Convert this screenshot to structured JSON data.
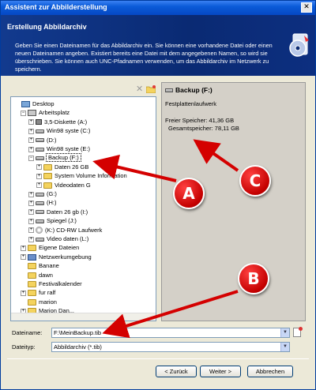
{
  "window": {
    "title": "Assistent zur Abbilderstellung",
    "close_glyph": "✕"
  },
  "banner": {
    "heading": "Erstellung Abbildarchiv",
    "description": "Geben Sie einen Dateinamen für das Abbildarchiv ein. Sie können eine vorhandene Datei oder einen neuen Dateinamen angeben. Existiert bereits eine Datei mit dem angegebenen Namen, so wird sie überschrieben. Sie können auch UNC-Pfadnamen verwenden, um das Abbildarchiv im Netzwerk zu speichern.",
    "icon": "wizard-disc-icon"
  },
  "tree": {
    "items": [
      {
        "label": "Desktop",
        "icon": "desktop-icon",
        "exp": ""
      },
      {
        "label": "Arbeitsplatz",
        "icon": "computer-icon",
        "exp": "−"
      },
      {
        "label": "3,5-Diskette (A:)",
        "icon": "floppy-icon",
        "exp": "+"
      },
      {
        "label": "Win98 syste (C:)",
        "icon": "drive-icon",
        "exp": "+"
      },
      {
        "label": "(D:)",
        "icon": "drive-icon",
        "exp": "+"
      },
      {
        "label": "Win98 syste (E:)",
        "icon": "drive-icon",
        "exp": "+"
      },
      {
        "label": "Backup (F:)",
        "icon": "drive-icon",
        "exp": "−",
        "selected": true
      },
      {
        "label": "Daten 26 GB",
        "icon": "folder-icon",
        "exp": "+"
      },
      {
        "label": "System Volume Information",
        "icon": "folder-icon",
        "exp": "+"
      },
      {
        "label": "Videodaten G",
        "icon": "folder-icon",
        "exp": "+"
      },
      {
        "label": "(G:)",
        "icon": "drive-icon",
        "exp": "+"
      },
      {
        "label": "(H:)",
        "icon": "drive-icon",
        "exp": "+"
      },
      {
        "label": "Daten 26 gb (I:)",
        "icon": "drive-icon",
        "exp": "+"
      },
      {
        "label": "Spiegel (J:)",
        "icon": "drive-icon",
        "exp": "+"
      },
      {
        "label": "(K:) CD-RW Laufwerk",
        "icon": "cd-icon",
        "exp": "+"
      },
      {
        "label": "Video daten (L:)",
        "icon": "drive-icon",
        "exp": "+"
      },
      {
        "label": "Eigene Dateien",
        "icon": "folder-icon",
        "exp": "+"
      },
      {
        "label": "Netzwerkumgebung",
        "icon": "network-icon",
        "exp": "+"
      },
      {
        "label": "Banane",
        "icon": "folder-icon",
        "exp": ""
      },
      {
        "label": "dawn",
        "icon": "folder-icon",
        "exp": ""
      },
      {
        "label": "Festivalkalender",
        "icon": "folder-icon",
        "exp": ""
      },
      {
        "label": "fur ralf",
        "icon": "folder-icon",
        "exp": "+"
      },
      {
        "label": "marion",
        "icon": "folder-icon",
        "exp": ""
      },
      {
        "label": "Marion Dan...",
        "icon": "folder-icon",
        "exp": "+"
      }
    ]
  },
  "info": {
    "drive_title": "Backup (F:)",
    "drive_type": "Festplattenlaufwerk",
    "free": "Freier Speicher: 41,36 GB",
    "total": "Gesamtspeicher: 78,11 GB"
  },
  "form": {
    "filename_label": "Dateiname:",
    "filename_value": "F:\\MeinBackup.tib",
    "filetype_label": "Dateityp:",
    "filetype_value": "Abbildarchiv (*.tib)"
  },
  "buttons": {
    "back": "< Zurück",
    "next": "Weiter >",
    "cancel": "Abbrechen"
  },
  "callouts": {
    "a": "A",
    "b": "B",
    "c": "C"
  },
  "colors": {
    "titlebar": "#0a5bd8",
    "banner": "#0a2a73",
    "callout": "#d40000"
  }
}
